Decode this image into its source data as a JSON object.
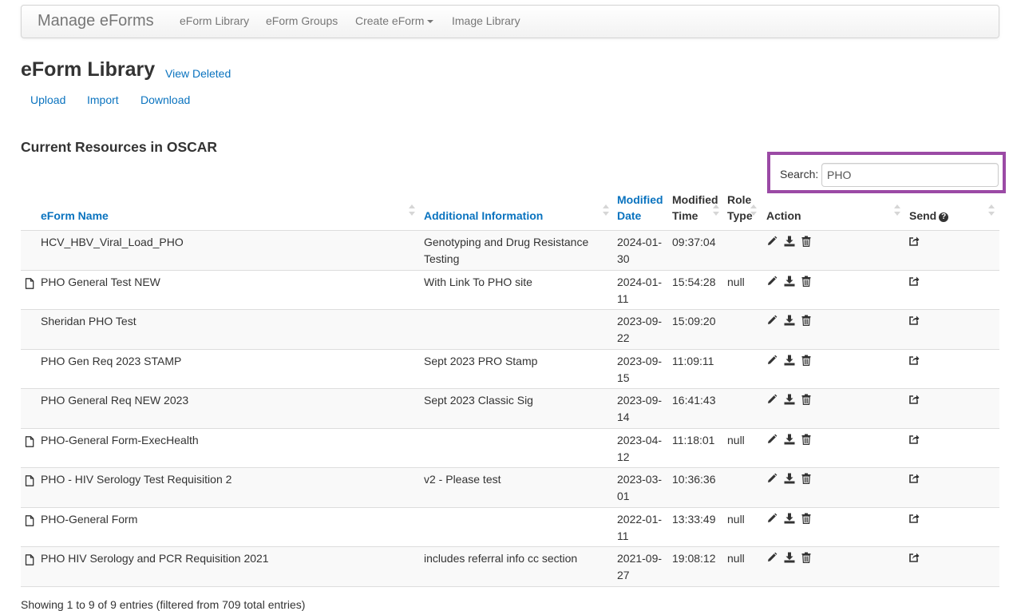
{
  "navbar": {
    "brand": "Manage eForms",
    "items": [
      "eForm Library",
      "eForm Groups",
      "Create eForm",
      "Image Library"
    ]
  },
  "page": {
    "title": "eForm Library",
    "view_deleted": "View Deleted",
    "links": [
      "Upload",
      "Import",
      "Download"
    ],
    "section_title": "Current Resources in OSCAR"
  },
  "search": {
    "label": "Search:",
    "value": "PHO"
  },
  "table": {
    "columns": {
      "name": "eForm Name",
      "info": "Additional Information",
      "modified_date": "Modified Date",
      "modified_time": "Modified Time",
      "role_type": "Role Type",
      "action": "Action",
      "send": "Send"
    },
    "rows": [
      {
        "name": "HCV_HBV_Viral_Load_PHO",
        "info": "Genotyping and Drug Resistance Testing",
        "date": "2024-01-30",
        "time": "09:37:04",
        "role": "",
        "file_icon": false
      },
      {
        "name": "PHO General Test NEW",
        "info": "With Link To PHO site",
        "date": "2024-01-11",
        "time": "15:54:28",
        "role": "null",
        "file_icon": true
      },
      {
        "name": "Sheridan PHO Test",
        "info": "",
        "date": "2023-09-22",
        "time": "15:09:20",
        "role": "",
        "file_icon": false
      },
      {
        "name": "PHO Gen Req 2023 STAMP",
        "info": "Sept 2023 PRO Stamp",
        "date": "2023-09-15",
        "time": "11:09:11",
        "role": "",
        "file_icon": false
      },
      {
        "name": "PHO General Req NEW 2023",
        "info": "Sept 2023 Classic Sig",
        "date": "2023-09-14",
        "time": "16:41:43",
        "role": "",
        "file_icon": false
      },
      {
        "name": "PHO-General Form-ExecHealth",
        "info": "",
        "date": "2023-04-12",
        "time": "11:18:01",
        "role": "null",
        "file_icon": true
      },
      {
        "name": "PHO - HIV Serology Test Requisition 2",
        "info": "v2 - Please test",
        "date": "2023-03-01",
        "time": "10:36:36",
        "role": "",
        "file_icon": true
      },
      {
        "name": "PHO-General Form",
        "info": "",
        "date": "2022-01-11",
        "time": "13:33:49",
        "role": "null",
        "file_icon": true
      },
      {
        "name": "PHO HIV Serology and PCR Requisition 2021",
        "info": "includes referral info cc section",
        "date": "2021-09-27",
        "time": "19:08:12",
        "role": "null",
        "file_icon": true
      }
    ]
  },
  "footer": {
    "info": "Showing 1 to 9 of 9 entries (filtered from 709 total entries)"
  },
  "colors": {
    "link": "#0a73bf",
    "highlight": "#9b4aa5",
    "stripe": "#f9f9f9"
  }
}
